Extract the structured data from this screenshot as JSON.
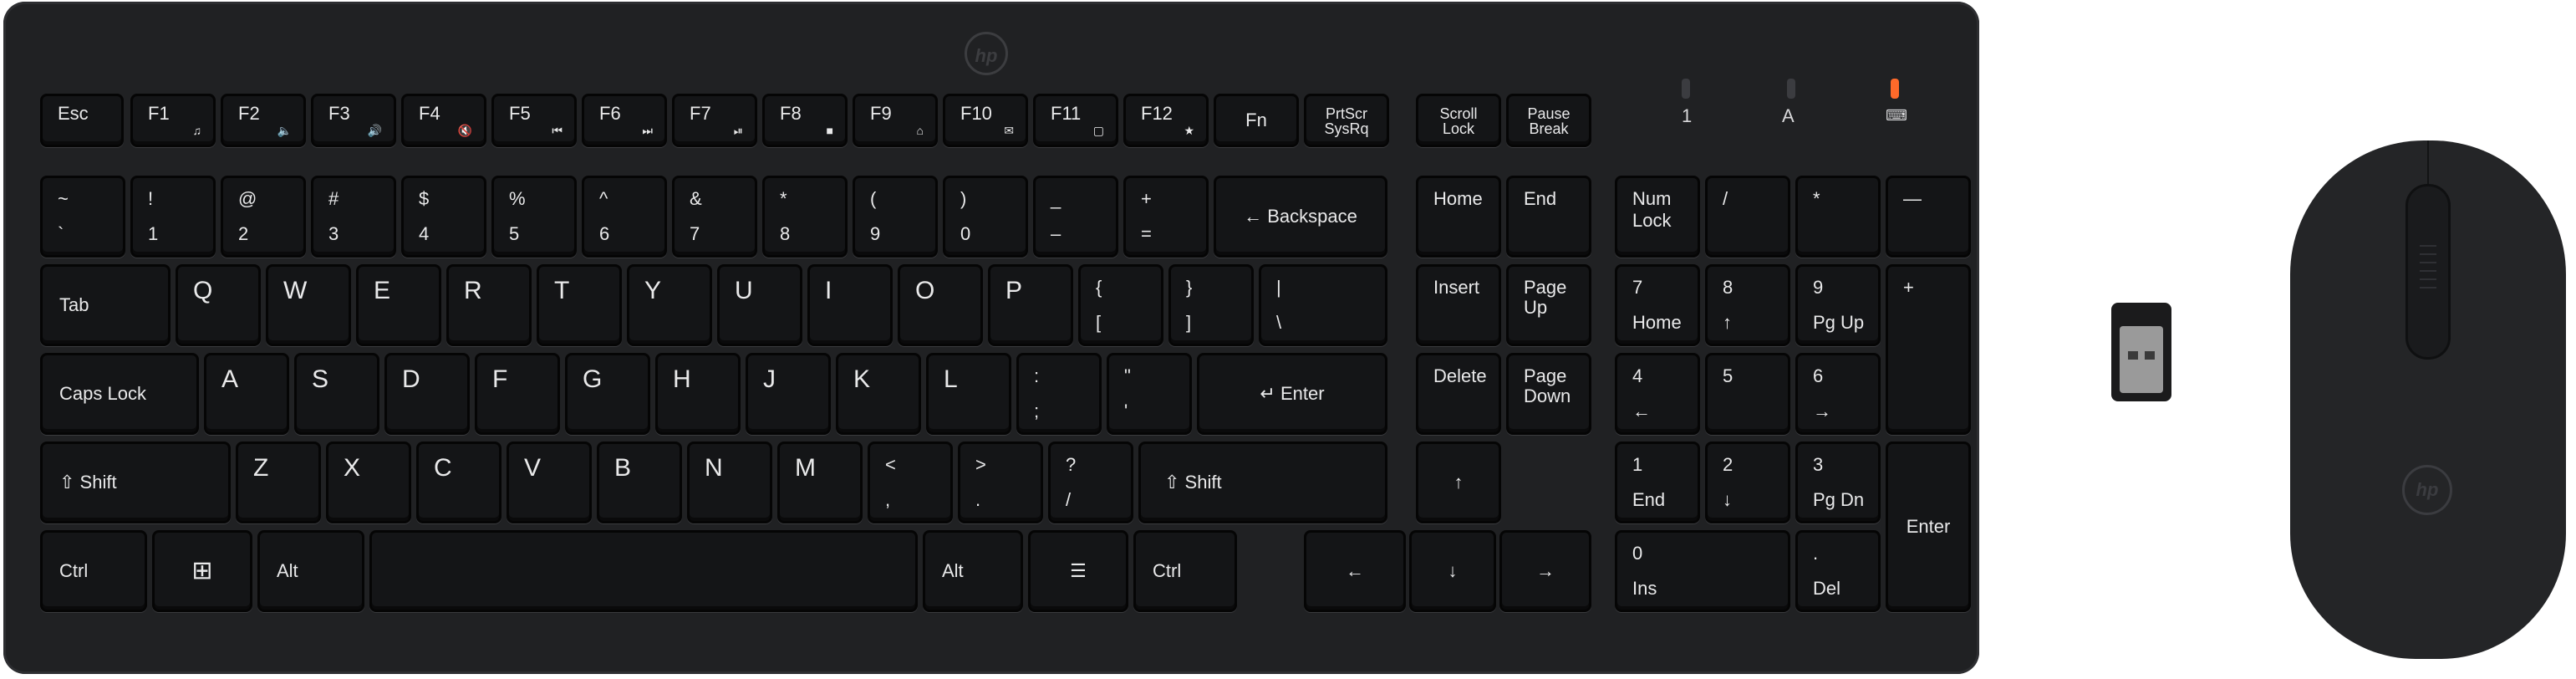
{
  "brand": {
    "logo": "hp"
  },
  "indicators": [
    "1",
    "A",
    "⌨"
  ],
  "colors": {
    "body": "#202123",
    "key": "#141517",
    "legend": "#e9e9ea",
    "indicator_active": "#ff6a2a"
  },
  "keys": {
    "esc": "Esc",
    "f1": "F1",
    "f2": "F2",
    "f3": "F3",
    "f4": "F4",
    "f5": "F5",
    "f6": "F6",
    "f7": "F7",
    "f8": "F8",
    "f9": "F9",
    "f10": "F10",
    "f11": "F11",
    "f12": "F12",
    "fn": "Fn",
    "prtscr": "PrtScr",
    "sysrq": "SysRq",
    "scroll": "Scroll",
    "lock": "Lock",
    "pause": "Pause",
    "break": "Break",
    "tilde_t": "~",
    "tilde_b": "`",
    "one_t": "!",
    "one_b": "1",
    "two_t": "@",
    "two_b": "2",
    "three_t": "#",
    "three_b": "3",
    "four_t": "$",
    "four_b": "4",
    "five_t": "%",
    "five_b": "5",
    "six_t": "^",
    "six_b": "6",
    "seven_t": "&",
    "seven_b": "7",
    "eight_t": "*",
    "eight_b": "8",
    "nine_t": "(",
    "nine_b": "9",
    "zero_t": ")",
    "zero_b": "0",
    "minus_t": "_",
    "minus_b": "–",
    "plus_t": "+",
    "plus_b": "=",
    "backspace": "← Backspace",
    "home": "Home",
    "end": "End",
    "insert": "Insert",
    "pageup_1": "Page",
    "pageup_2": "Up",
    "delete": "Delete",
    "pagedown_1": "Page",
    "pagedown_2": "Down",
    "numlock_1": "Num",
    "numlock_2": "Lock",
    "np_slash": "/",
    "np_star": "*",
    "np_minus": "—",
    "tab": "Tab",
    "q": "Q",
    "w": "W",
    "e": "E",
    "r": "R",
    "t": "T",
    "y": "Y",
    "u": "U",
    "i": "I",
    "o": "O",
    "p": "P",
    "lbr_t": "{",
    "lbr_b": "[",
    "rbr_t": "}",
    "rbr_b": "]",
    "bslash_t": "|",
    "bslash_b": "\\",
    "np7_t": "7",
    "np7_b": "Home",
    "np8_t": "8",
    "np8_b": "↑",
    "np9_t": "9",
    "np9_b": "Pg Up",
    "np_plus": "+",
    "capslock": "Caps Lock",
    "a": "A",
    "s": "S",
    "d": "D",
    "f": "F",
    "g": "G",
    "h": "H",
    "j": "J",
    "k": "K",
    "l": "L",
    "semi_t": ":",
    "semi_b": ";",
    "quote_t": "\"",
    "quote_b": "'",
    "enter": "↵ Enter",
    "np4_t": "4",
    "np4_b": "←",
    "np5_t": "5",
    "np6_t": "6",
    "np6_b": "→",
    "shift": "⇧ Shift",
    "z": "Z",
    "x": "X",
    "c": "C",
    "v": "V",
    "b": "B",
    "n": "N",
    "m": "M",
    "comma_t": "<",
    "comma_b": ",",
    "period_t": ">",
    "period_b": ".",
    "slash_t": "?",
    "slash_b": "/",
    "arrow_up": "↑",
    "np1_t": "1",
    "np1_b": "End",
    "np2_t": "2",
    "np2_b": "↓",
    "np3_t": "3",
    "np3_b": "Pg Dn",
    "np_enter": "Enter",
    "ctrl": "Ctrl",
    "win": "⊞",
    "alt": "Alt",
    "menu": "☰",
    "arrow_left": "←",
    "arrow_down": "↓",
    "arrow_right": "→",
    "np0_t": "0",
    "np0_b": "Ins",
    "npdot_t": ".",
    "npdot_b": "Del"
  },
  "fn_icons": {
    "f1": "♫",
    "f2": "🔈",
    "f3": "🔊",
    "f4": "🔇",
    "f5": "⏮",
    "f6": "⏭",
    "f7": "⏯",
    "f8": "■",
    "f9": "⌂",
    "f10": "✉",
    "f11": "▢",
    "f12": "★"
  }
}
